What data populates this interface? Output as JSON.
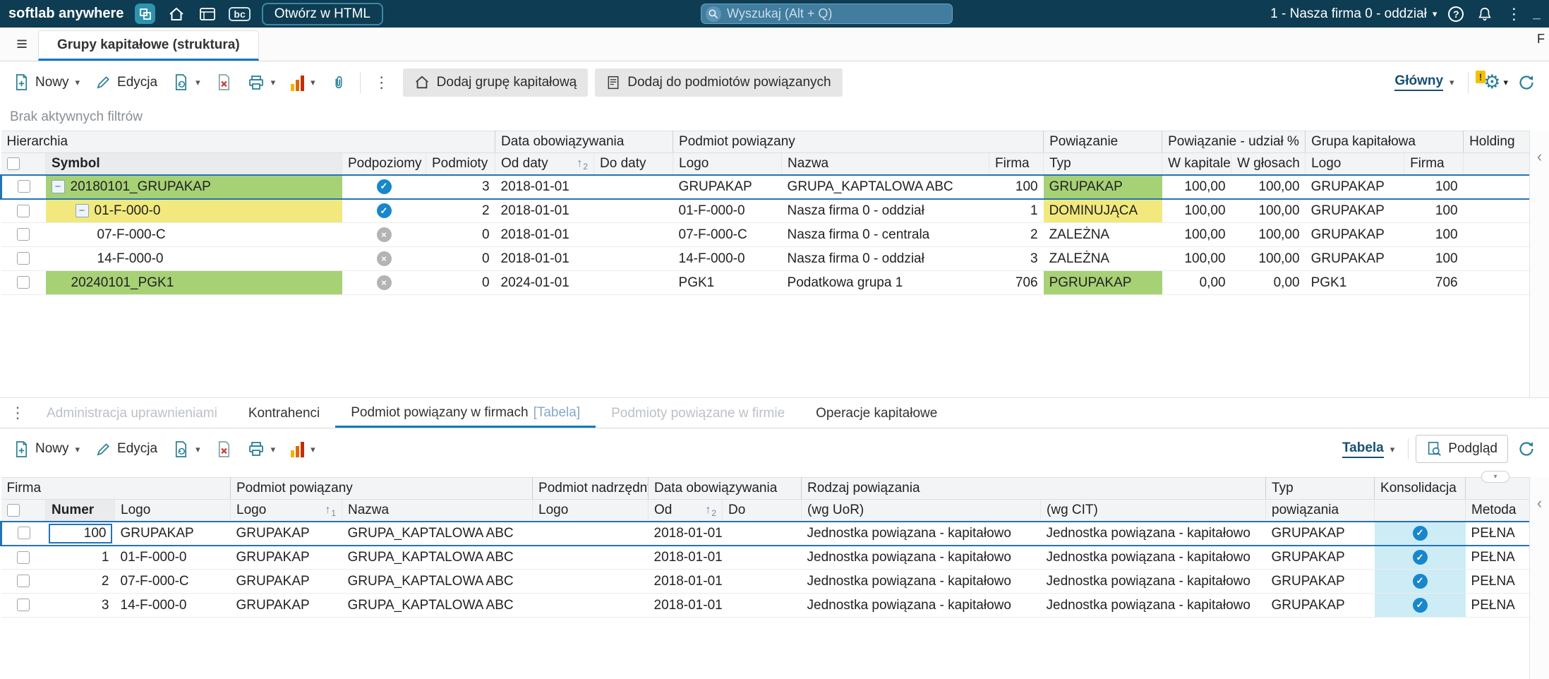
{
  "topbar": {
    "brand": "softlab anywhere",
    "bc_label": "bc",
    "open_html_button": "Otwórz w HTML",
    "search_placeholder": "Wyszukaj (Alt + Q)",
    "company_selector": "1 - Nasza firma 0 - oddział",
    "minimize_hint": "_"
  },
  "tabs": {
    "main": "Grupy kapitałowe (struktura)",
    "partial_label": "F"
  },
  "toolbar": {
    "new": "Nowy",
    "edit": "Edycja",
    "add_group": "Dodaj grupę kapitałową",
    "add_related": "Dodaj do podmiotów powiązanych",
    "view": "Główny"
  },
  "filters": {
    "note": "Brak aktywnych filtrów"
  },
  "main_table": {
    "groups": {
      "hierarchia": "Hierarchia",
      "data_obowiazywania": "Data obowiązywania",
      "podmiot_powiazany": "Podmiot powiązany",
      "powiazanie": "Powiązanie",
      "udzial": "Powiązanie - udział %",
      "grupa_kapitalowa": "Grupa kapitałowa",
      "holding": "Holding"
    },
    "columns": {
      "symbol": "Symbol",
      "podpoziomy": "Podpoziomy",
      "podmioty": "Podmioty",
      "od_daty": "Od daty",
      "do_daty": "Do daty",
      "logo": "Logo",
      "nazwa": "Nazwa",
      "firma": "Firma",
      "typ": "Typ",
      "w_kapitale": "W kapitale",
      "w_glosach": "W głosach",
      "gk_logo": "Logo",
      "gk_firma": "Firma"
    },
    "sort_rank_od": "2",
    "rows": [
      {
        "symbol": "20180101_GRUPAKAP",
        "podmioty": "3",
        "od": "2018-01-01",
        "do": "",
        "logo": "GRUPAKAP",
        "nazwa": "GRUPA_KAPTALOWA ABC",
        "firma": "100",
        "typ": "GRUPAKAP",
        "w_kapitale": "100,00",
        "w_glosach": "100,00",
        "gk_logo": "GRUPAKAP",
        "gk_firma": "100"
      },
      {
        "symbol": "01-F-000-0",
        "podmioty": "2",
        "od": "2018-01-01",
        "do": "",
        "logo": "01-F-000-0",
        "nazwa": "Nasza firma 0 - oddział",
        "firma": "1",
        "typ": "DOMINUJĄCA",
        "w_kapitale": "100,00",
        "w_glosach": "100,00",
        "gk_logo": "GRUPAKAP",
        "gk_firma": "100"
      },
      {
        "symbol": "07-F-000-C",
        "podmioty": "0",
        "od": "2018-01-01",
        "do": "",
        "logo": "07-F-000-C",
        "nazwa": "Nasza firma 0 - centrala",
        "firma": "2",
        "typ": "ZALEŻNA",
        "w_kapitale": "100,00",
        "w_glosach": "100,00",
        "gk_logo": "GRUPAKAP",
        "gk_firma": "100"
      },
      {
        "symbol": "14-F-000-0",
        "podmioty": "0",
        "od": "2018-01-01",
        "do": "",
        "logo": "14-F-000-0",
        "nazwa": "Nasza firma 0 - oddział",
        "firma": "3",
        "typ": "ZALEŻNA",
        "w_kapitale": "100,00",
        "w_glosach": "100,00",
        "gk_logo": "GRUPAKAP",
        "gk_firma": "100"
      },
      {
        "symbol": "20240101_PGK1",
        "podmioty": "0",
        "od": "2024-01-01",
        "do": "",
        "logo": "PGK1",
        "nazwa": "Podatkowa grupa 1",
        "firma": "706",
        "typ": "PGRUPAKAP",
        "w_kapitale": "0,00",
        "w_glosach": "0,00",
        "gk_logo": "PGK1",
        "gk_firma": "706"
      }
    ]
  },
  "bottom_tabs": {
    "items": [
      {
        "label": "Administracja uprawnieniami",
        "state": "disabled"
      },
      {
        "label": "Kontrahenci",
        "state": "normal"
      },
      {
        "label": "Podmiot powiązany w firmach",
        "suffix": "[Tabela]",
        "state": "active"
      },
      {
        "label": "Podmioty powiązane w firmie",
        "state": "disabled"
      },
      {
        "label": "Operacje kapitałowe",
        "state": "normal"
      }
    ]
  },
  "bottom_toolbar": {
    "new": "Nowy",
    "edit": "Edycja",
    "view": "Tabela",
    "preview": "Podgląd"
  },
  "bottom_table": {
    "groups": {
      "firma": "Firma",
      "podmiot_powiazany": "Podmiot powiązany",
      "podmiot_nadrzedny": "Podmiot nadrzędny",
      "data_obowiazywania": "Data obowiązywania",
      "rodzaj_powiazania": "Rodzaj powiązania",
      "typ": "Typ",
      "konsolidacja": "Konsolidacja"
    },
    "columns": {
      "numer": "Numer",
      "logo_firma": "Logo",
      "logo_pp": "Logo",
      "nazwa": "Nazwa",
      "logo_nadrz": "Logo",
      "od": "Od",
      "do": "Do",
      "wg_uor": "(wg UoR)",
      "wg_cit": "(wg CIT)",
      "powiazania": "powiązania",
      "metoda": "Metoda"
    },
    "sort_rank_logo": "1",
    "sort_rank_od": "2",
    "rows": [
      {
        "numer": "100",
        "logo_firma": "GRUPAKAP",
        "logo_pp": "GRUPAKAP",
        "nazwa": "GRUPA_KAPTALOWA ABC",
        "logo_nadrz": "",
        "od": "2018-01-01",
        "do": "",
        "wg_uor": "Jednostka powiązana - kapitałowo",
        "wg_cit": "Jednostka powiązana - kapitałowo",
        "typ": "GRUPAKAP",
        "metoda": "PEŁNA"
      },
      {
        "numer": "1",
        "logo_firma": "01-F-000-0",
        "logo_pp": "GRUPAKAP",
        "nazwa": "GRUPA_KAPTALOWA ABC",
        "logo_nadrz": "",
        "od": "2018-01-01",
        "do": "",
        "wg_uor": "Jednostka powiązana - kapitałowo",
        "wg_cit": "Jednostka powiązana - kapitałowo",
        "typ": "GRUPAKAP",
        "metoda": "PEŁNA"
      },
      {
        "numer": "2",
        "logo_firma": "07-F-000-C",
        "logo_pp": "GRUPAKAP",
        "nazwa": "GRUPA_KAPTALOWA ABC",
        "logo_nadrz": "",
        "od": "2018-01-01",
        "do": "",
        "wg_uor": "Jednostka powiązana - kapitałowo",
        "wg_cit": "Jednostka powiązana - kapitałowo",
        "typ": "GRUPAKAP",
        "metoda": "PEŁNA"
      },
      {
        "numer": "3",
        "logo_firma": "14-F-000-0",
        "logo_pp": "GRUPAKAP",
        "nazwa": "GRUPA_KAPTALOWA ABC",
        "logo_nadrz": "",
        "od": "2018-01-01",
        "do": "",
        "wg_uor": "Jednostka powiązana - kapitałowo",
        "wg_cit": "Jednostka powiązana - kapitałowo",
        "typ": "GRUPAKAP",
        "metoda": "PEŁNA"
      }
    ]
  },
  "icons": {
    "hamburger": "≡",
    "chevron_down": "▾",
    "kebab": "⋮",
    "gear": "⚙",
    "question": "?",
    "minus": "−",
    "check": "✓",
    "cross": "×",
    "sort_up": "↑",
    "collapse_left": "‹",
    "warning": "!"
  },
  "colors": {
    "topbar_bg": "#0e3c52",
    "accent_blue": "#1478c2",
    "selected_border": "#2273b8",
    "green_highlight": "#a7d175",
    "yellow_highlight": "#f2e97e",
    "konsolidacja_bg": "#cdecf6",
    "check_circle": "#1887cb",
    "cross_circle": "#b4b4b4",
    "link_blue": "#174f77",
    "icon_teal": "#2a7f96",
    "warning_yellow": "#f2c200"
  }
}
